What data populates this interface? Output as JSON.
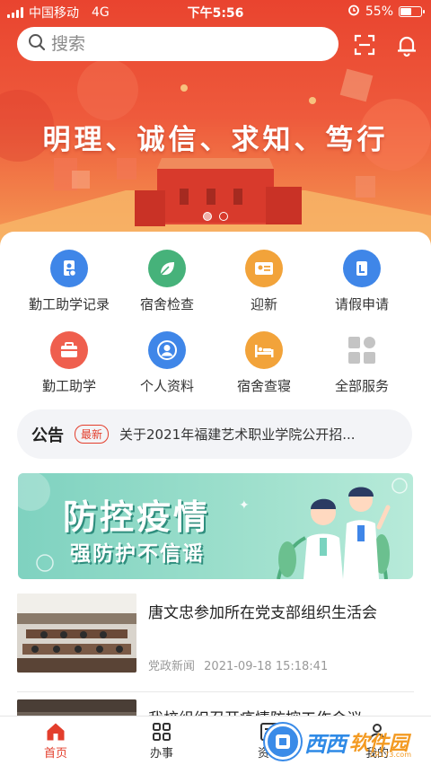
{
  "status_bar": {
    "carrier": "中国移动",
    "network": "4G",
    "time": "下午5:56",
    "battery": "55%",
    "battery_level": 0.55
  },
  "search": {
    "placeholder": "搜索"
  },
  "banner": {
    "slogan": "明理、诚信、求知、笃行",
    "slides": 2,
    "active_slide": 1
  },
  "services": [
    {
      "label": "勤工助学记录",
      "icon": "id-badge-icon",
      "color": "#3f86e8"
    },
    {
      "label": "宿舍检查",
      "icon": "leaf-icon",
      "color": "#46b27a"
    },
    {
      "label": "迎新",
      "icon": "id-card-icon",
      "color": "#f2a33a"
    },
    {
      "label": "请假申请",
      "icon": "document-icon",
      "color": "#3f86e8"
    },
    {
      "label": "勤工助学",
      "icon": "briefcase-icon",
      "color": "#ef5f4e"
    },
    {
      "label": "个人资料",
      "icon": "person-icon",
      "color": "#3f86e8"
    },
    {
      "label": "宿舍查寝",
      "icon": "bed-icon",
      "color": "#f2a33a"
    },
    {
      "label": "全部服务",
      "icon": "grid-icon",
      "color": "#bdbdbd"
    }
  ],
  "notice": {
    "title": "公告",
    "badge": "最新",
    "text": "关于2021年福建艺术职业学院公开招..."
  },
  "promo": {
    "line1": "防控疫情",
    "line2": "强防护不信谣"
  },
  "news": [
    {
      "title": "唐文忠参加所在党支部组织生活会",
      "category": "党政新闻",
      "date": "2021-09-18 15:18:41"
    },
    {
      "title": "我校组织召开疫情防控工作会议",
      "category": "",
      "date": ""
    }
  ],
  "tabs": [
    {
      "label": "首页",
      "icon": "home-icon",
      "active": true
    },
    {
      "label": "办事",
      "icon": "grid-icon",
      "active": false
    },
    {
      "label": "资讯",
      "icon": "news-icon",
      "active": false
    },
    {
      "label": "我的",
      "icon": "person-icon",
      "active": false
    }
  ],
  "watermark": {
    "text1": "西西",
    "text2": "软件园",
    "text3": "CR173.com"
  },
  "colors": {
    "accent": "#e33e2c",
    "banner_top": "#e9442f"
  }
}
